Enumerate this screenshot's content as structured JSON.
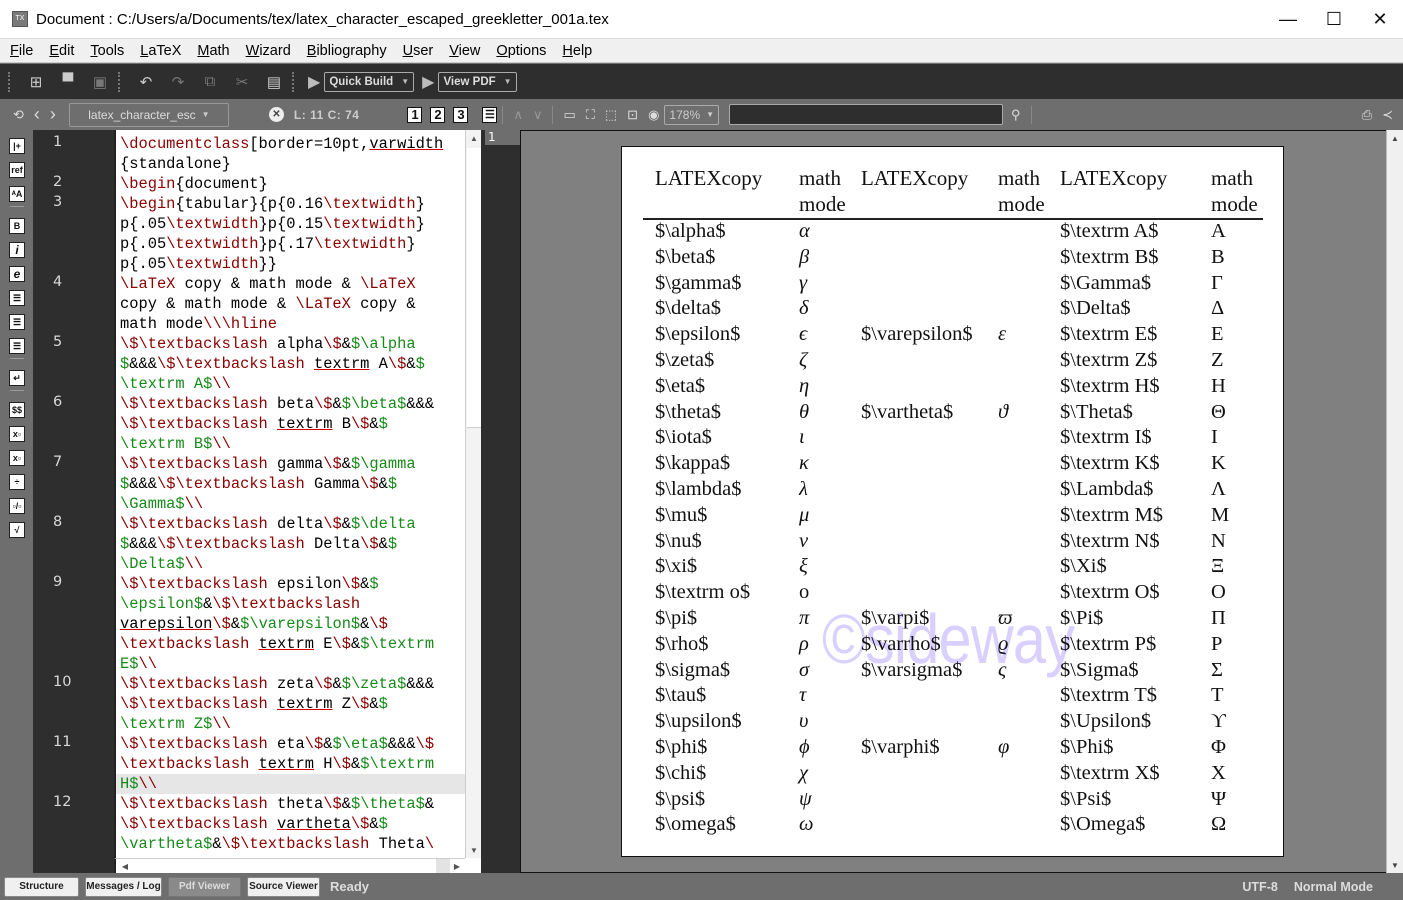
{
  "window": {
    "title": "Document : C:/Users/a/Documents/tex/latex_character_escaped_greekletter_001a.tex",
    "controls": {
      "minimize": "—",
      "maximize": "☐",
      "close": "✕"
    }
  },
  "menu": [
    {
      "u": "F",
      "rest": "ile"
    },
    {
      "u": "E",
      "rest": "dit"
    },
    {
      "u": "T",
      "rest": "ools"
    },
    {
      "u": "L",
      "rest": "aTeX"
    },
    {
      "u": "M",
      "rest": "ath"
    },
    {
      "u": "W",
      "rest": "izard"
    },
    {
      "u": "B",
      "rest": "ibliography"
    },
    {
      "u": "U",
      "rest": "ser"
    },
    {
      "u": "V",
      "rest": "iew"
    },
    {
      "u": "O",
      "rest": "ptions"
    },
    {
      "u": "H",
      "rest": "elp"
    }
  ],
  "toolbar": {
    "quick_build": "Quick Build",
    "view_pdf": "View PDF",
    "icons": {
      "new": "⊞",
      "open": "▬",
      "save": "🖫",
      "undo": "↶",
      "redo": "↷",
      "copy": "⧉",
      "cut": "✂",
      "paste": "📋",
      "play": "▶",
      "caret": "▾"
    }
  },
  "toolbar2": {
    "file_combo": "latex_character_esc",
    "cursor_position": "L: 11 C: 74",
    "split_buttons": [
      "1",
      "2",
      "3"
    ],
    "zoom_level": "178%",
    "search_value": ""
  },
  "left_panel_icons": [
    {
      "name": "insert-structure-icon",
      "glyph": "|+"
    },
    {
      "name": "ref-icon",
      "glyph": "ref"
    },
    {
      "name": "font-size-icon",
      "glyph": "ᴬA"
    },
    {
      "name": "bold-icon",
      "glyph": "B"
    },
    {
      "name": "italic-icon",
      "glyph": "i"
    },
    {
      "name": "emphasis-icon",
      "glyph": "e"
    },
    {
      "name": "align-left-icon",
      "glyph": "☰"
    },
    {
      "name": "align-center-icon",
      "glyph": "☰"
    },
    {
      "name": "align-right-icon",
      "glyph": "☰"
    },
    {
      "name": "newline-icon",
      "glyph": "↵"
    },
    {
      "name": "inline-math-icon",
      "glyph": "$$"
    },
    {
      "name": "subscript-icon",
      "glyph": "x▫"
    },
    {
      "name": "superscript-icon",
      "glyph": "x▫"
    },
    {
      "name": "divide-icon",
      "glyph": "÷"
    },
    {
      "name": "fraction-icon",
      "glyph": "▫/▫"
    },
    {
      "name": "sqrt-icon",
      "glyph": "√"
    }
  ],
  "editor": {
    "line_numbers": [
      {
        "n": "1",
        "row": 0
      },
      {
        "n": "2",
        "row": 2
      },
      {
        "n": "3",
        "row": 3
      },
      {
        "n": "4",
        "row": 7
      },
      {
        "n": "5",
        "row": 10
      },
      {
        "n": "6",
        "row": 13
      },
      {
        "n": "7",
        "row": 16
      },
      {
        "n": "8",
        "row": 19
      },
      {
        "n": "9",
        "row": 22
      },
      {
        "n": "10",
        "row": 27
      },
      {
        "n": "11",
        "row": 30
      },
      {
        "n": "12",
        "row": 33
      }
    ],
    "current_row": 32,
    "rows": [
      [
        [
          "k",
          "\\documentclass"
        ],
        [
          "t",
          "[border=10pt,"
        ],
        [
          "u",
          "varwidth"
        ]
      ],
      [
        [
          "t",
          "{standalone}"
        ]
      ],
      [
        [
          "k",
          "\\begin"
        ],
        [
          "t",
          "{document}"
        ]
      ],
      [
        [
          "k",
          "\\begin"
        ],
        [
          "t",
          "{tabular}{p{0.16"
        ],
        [
          "k",
          "\\textwidth"
        ],
        [
          "t",
          "}"
        ]
      ],
      [
        [
          "t",
          "p{.05"
        ],
        [
          "k",
          "\\textwidth"
        ],
        [
          "t",
          "}p{0.15"
        ],
        [
          "k",
          "\\textwidth"
        ],
        [
          "t",
          "}"
        ]
      ],
      [
        [
          "t",
          "p{.05"
        ],
        [
          "k",
          "\\textwidth"
        ],
        [
          "t",
          "}p{.17"
        ],
        [
          "k",
          "\\textwidth"
        ],
        [
          "t",
          "}"
        ]
      ],
      [
        [
          "t",
          "p{.05"
        ],
        [
          "k",
          "\\textwidth"
        ],
        [
          "t",
          "}}"
        ]
      ],
      [
        [
          "k",
          "\\LaTeX"
        ],
        [
          "t",
          " copy & math mode & "
        ],
        [
          "k",
          "\\LaTeX"
        ]
      ],
      [
        [
          "t",
          "copy & math mode & "
        ],
        [
          "k",
          "\\LaTeX"
        ],
        [
          "t",
          " copy &"
        ]
      ],
      [
        [
          "t",
          "math mode"
        ],
        [
          "k",
          "\\\\\\hline"
        ]
      ],
      [
        [
          "k",
          "\\$\\textbackslash"
        ],
        [
          "t",
          " alpha"
        ],
        [
          "k",
          "\\$"
        ],
        [
          "t",
          "&"
        ],
        [
          "m",
          "$\\alpha"
        ]
      ],
      [
        [
          "m",
          "$"
        ],
        [
          "t",
          "&&&"
        ],
        [
          "k",
          "\\$\\textbackslash"
        ],
        [
          "t",
          " "
        ],
        [
          "u",
          "textrm"
        ],
        [
          "t",
          " A"
        ],
        [
          "k",
          "\\$"
        ],
        [
          "t",
          "&"
        ],
        [
          "m",
          "$"
        ]
      ],
      [
        [
          "m",
          "\\textrm A$"
        ],
        [
          "k",
          "\\\\"
        ]
      ],
      [
        [
          "k",
          "\\$\\textbackslash"
        ],
        [
          "t",
          " beta"
        ],
        [
          "k",
          "\\$"
        ],
        [
          "t",
          "&"
        ],
        [
          "m",
          "$\\beta$"
        ],
        [
          "t",
          "&&&"
        ]
      ],
      [
        [
          "k",
          "\\$\\textbackslash"
        ],
        [
          "t",
          " "
        ],
        [
          "u",
          "textrm"
        ],
        [
          "t",
          " B"
        ],
        [
          "k",
          "\\$"
        ],
        [
          "t",
          "&"
        ],
        [
          "m",
          "$"
        ]
      ],
      [
        [
          "m",
          "\\textrm B$"
        ],
        [
          "k",
          "\\\\"
        ]
      ],
      [
        [
          "k",
          "\\$\\textbackslash"
        ],
        [
          "t",
          " gamma"
        ],
        [
          "k",
          "\\$"
        ],
        [
          "t",
          "&"
        ],
        [
          "m",
          "$\\gamma"
        ]
      ],
      [
        [
          "m",
          "$"
        ],
        [
          "t",
          "&&&"
        ],
        [
          "k",
          "\\$\\textbackslash"
        ],
        [
          "t",
          " Gamma"
        ],
        [
          "k",
          "\\$"
        ],
        [
          "t",
          "&"
        ],
        [
          "m",
          "$"
        ]
      ],
      [
        [
          "m",
          "\\Gamma$"
        ],
        [
          "k",
          "\\\\"
        ]
      ],
      [
        [
          "k",
          "\\$\\textbackslash"
        ],
        [
          "t",
          " delta"
        ],
        [
          "k",
          "\\$"
        ],
        [
          "t",
          "&"
        ],
        [
          "m",
          "$\\delta"
        ]
      ],
      [
        [
          "m",
          "$"
        ],
        [
          "t",
          "&&&"
        ],
        [
          "k",
          "\\$\\textbackslash"
        ],
        [
          "t",
          " Delta"
        ],
        [
          "k",
          "\\$"
        ],
        [
          "t",
          "&"
        ],
        [
          "m",
          "$"
        ]
      ],
      [
        [
          "m",
          "\\Delta$"
        ],
        [
          "k",
          "\\\\"
        ]
      ],
      [
        [
          "k",
          "\\$\\textbackslash"
        ],
        [
          "t",
          " epsilon"
        ],
        [
          "k",
          "\\$"
        ],
        [
          "t",
          "&"
        ],
        [
          "m",
          "$"
        ]
      ],
      [
        [
          "m",
          "\\epsilon$"
        ],
        [
          "t",
          "&"
        ],
        [
          "k",
          "\\$\\textbackslash"
        ]
      ],
      [
        [
          "u",
          "varepsilon"
        ],
        [
          "k",
          "\\$"
        ],
        [
          "t",
          "&"
        ],
        [
          "m",
          "$\\varepsilon$"
        ],
        [
          "t",
          "&"
        ],
        [
          "k",
          "\\$"
        ]
      ],
      [
        [
          "k",
          "\\textbackslash"
        ],
        [
          "t",
          " "
        ],
        [
          "u",
          "textrm"
        ],
        [
          "t",
          " E"
        ],
        [
          "k",
          "\\$"
        ],
        [
          "t",
          "&"
        ],
        [
          "m",
          "$\\textrm"
        ]
      ],
      [
        [
          "m",
          "E$"
        ],
        [
          "k",
          "\\\\"
        ]
      ],
      [
        [
          "k",
          "\\$\\textbackslash"
        ],
        [
          "t",
          " zeta"
        ],
        [
          "k",
          "\\$"
        ],
        [
          "t",
          "&"
        ],
        [
          "m",
          "$\\zeta$"
        ],
        [
          "t",
          "&&&"
        ]
      ],
      [
        [
          "k",
          "\\$\\textbackslash"
        ],
        [
          "t",
          " "
        ],
        [
          "u",
          "textrm"
        ],
        [
          "t",
          " Z"
        ],
        [
          "k",
          "\\$"
        ],
        [
          "t",
          "&"
        ],
        [
          "m",
          "$"
        ]
      ],
      [
        [
          "m",
          "\\textrm Z$"
        ],
        [
          "k",
          "\\\\"
        ]
      ],
      [
        [
          "k",
          "\\$\\textbackslash"
        ],
        [
          "t",
          " eta"
        ],
        [
          "k",
          "\\$"
        ],
        [
          "t",
          "&"
        ],
        [
          "m",
          "$\\eta$"
        ],
        [
          "t",
          "&&&"
        ],
        [
          "k",
          "\\$"
        ]
      ],
      [
        [
          "k",
          "\\textbackslash"
        ],
        [
          "t",
          " "
        ],
        [
          "u",
          "textrm"
        ],
        [
          "t",
          " H"
        ],
        [
          "k",
          "\\$"
        ],
        [
          "t",
          "&"
        ],
        [
          "m",
          "$\\textrm"
        ]
      ],
      [
        [
          "m",
          "H$"
        ],
        [
          "k",
          "\\\\"
        ]
      ],
      [
        [
          "k",
          "\\$\\textbackslash"
        ],
        [
          "t",
          " theta"
        ],
        [
          "k",
          "\\$"
        ],
        [
          "t",
          "&"
        ],
        [
          "m",
          "$\\theta$"
        ],
        [
          "t",
          "&"
        ]
      ],
      [
        [
          "k",
          "\\$\\textbackslash"
        ],
        [
          "t",
          " "
        ],
        [
          "u",
          "vartheta"
        ],
        [
          "k",
          "\\$"
        ],
        [
          "t",
          "&"
        ],
        [
          "m",
          "$"
        ]
      ],
      [
        [
          "m",
          "\\vartheta$"
        ],
        [
          "t",
          "&"
        ],
        [
          "k",
          "\\$\\textbackslash"
        ],
        [
          "t",
          " Theta"
        ],
        [
          "k",
          "\\"
        ]
      ]
    ]
  },
  "pdf": {
    "page_number": "1",
    "headers": [
      {
        "line1": "LATEXcopy",
        "line2": ""
      },
      {
        "line1": "math",
        "line2": "mode"
      },
      {
        "line1": "LATEXcopy",
        "line2": ""
      },
      {
        "line1": "math",
        "line2": "mode"
      },
      {
        "line1": "LATEXcopy",
        "line2": ""
      },
      {
        "line1": "math",
        "line2": "mode"
      }
    ],
    "rows": [
      [
        "$\\alpha$",
        "α",
        "",
        "",
        "$\\textrm A$",
        "A"
      ],
      [
        "$\\beta$",
        "β",
        "",
        "",
        "$\\textrm B$",
        "B"
      ],
      [
        "$\\gamma$",
        "γ",
        "",
        "",
        "$\\Gamma$",
        "Γ"
      ],
      [
        "$\\delta$",
        "δ",
        "",
        "",
        "$\\Delta$",
        "Δ"
      ],
      [
        "$\\epsilon$",
        "ϵ",
        "$\\varepsilon$",
        "ε",
        "$\\textrm E$",
        "E"
      ],
      [
        "$\\zeta$",
        "ζ",
        "",
        "",
        "$\\textrm Z$",
        "Z"
      ],
      [
        "$\\eta$",
        "η",
        "",
        "",
        "$\\textrm H$",
        "H"
      ],
      [
        "$\\theta$",
        "θ",
        "$\\vartheta$",
        "ϑ",
        "$\\Theta$",
        "Θ"
      ],
      [
        "$\\iota$",
        "ι",
        "",
        "",
        "$\\textrm I$",
        "I"
      ],
      [
        "$\\kappa$",
        "κ",
        "",
        "",
        "$\\textrm K$",
        "K"
      ],
      [
        "$\\lambda$",
        "λ",
        "",
        "",
        "$\\Lambda$",
        "Λ"
      ],
      [
        "$\\mu$",
        "μ",
        "",
        "",
        "$\\textrm M$",
        "M"
      ],
      [
        "$\\nu$",
        "ν",
        "",
        "",
        "$\\textrm N$",
        "N"
      ],
      [
        "$\\xi$",
        "ξ",
        "",
        "",
        "$\\Xi$",
        "Ξ"
      ],
      [
        "$\\textrm o$",
        "o",
        "",
        "",
        "$\\textrm O$",
        "O"
      ],
      [
        "$\\pi$",
        "π",
        "$\\varpi$",
        "ϖ",
        "$\\Pi$",
        "Π"
      ],
      [
        "$\\rho$",
        "ρ",
        "$\\varrho$",
        "ϱ",
        "$\\textrm P$",
        "P"
      ],
      [
        "$\\sigma$",
        "σ",
        "$\\varsigma$",
        "ς",
        "$\\Sigma$",
        "Σ"
      ],
      [
        "$\\tau$",
        "τ",
        "",
        "",
        "$\\textrm T$",
        "T"
      ],
      [
        "$\\upsilon$",
        "υ",
        "",
        "",
        "$\\Upsilon$",
        "ϒ"
      ],
      [
        "$\\phi$",
        "ϕ",
        "$\\varphi$",
        "φ",
        "$\\Phi$",
        "Φ"
      ],
      [
        "$\\chi$",
        "χ",
        "",
        "",
        "$\\textrm X$",
        "X"
      ],
      [
        "$\\psi$",
        "ψ",
        "",
        "",
        "$\\Psi$",
        "Ψ"
      ],
      [
        "$\\omega$",
        "ω",
        "",
        "",
        "$\\Omega$",
        "Ω"
      ]
    ],
    "watermark": "©sideway"
  },
  "statusbar": {
    "tabs": [
      "Structure",
      "Messages / Log",
      "Pdf Viewer",
      "Source Viewer"
    ],
    "active_tab": "Pdf Viewer",
    "status": "Ready",
    "encoding": "UTF-8",
    "mode": "Normal Mode"
  }
}
